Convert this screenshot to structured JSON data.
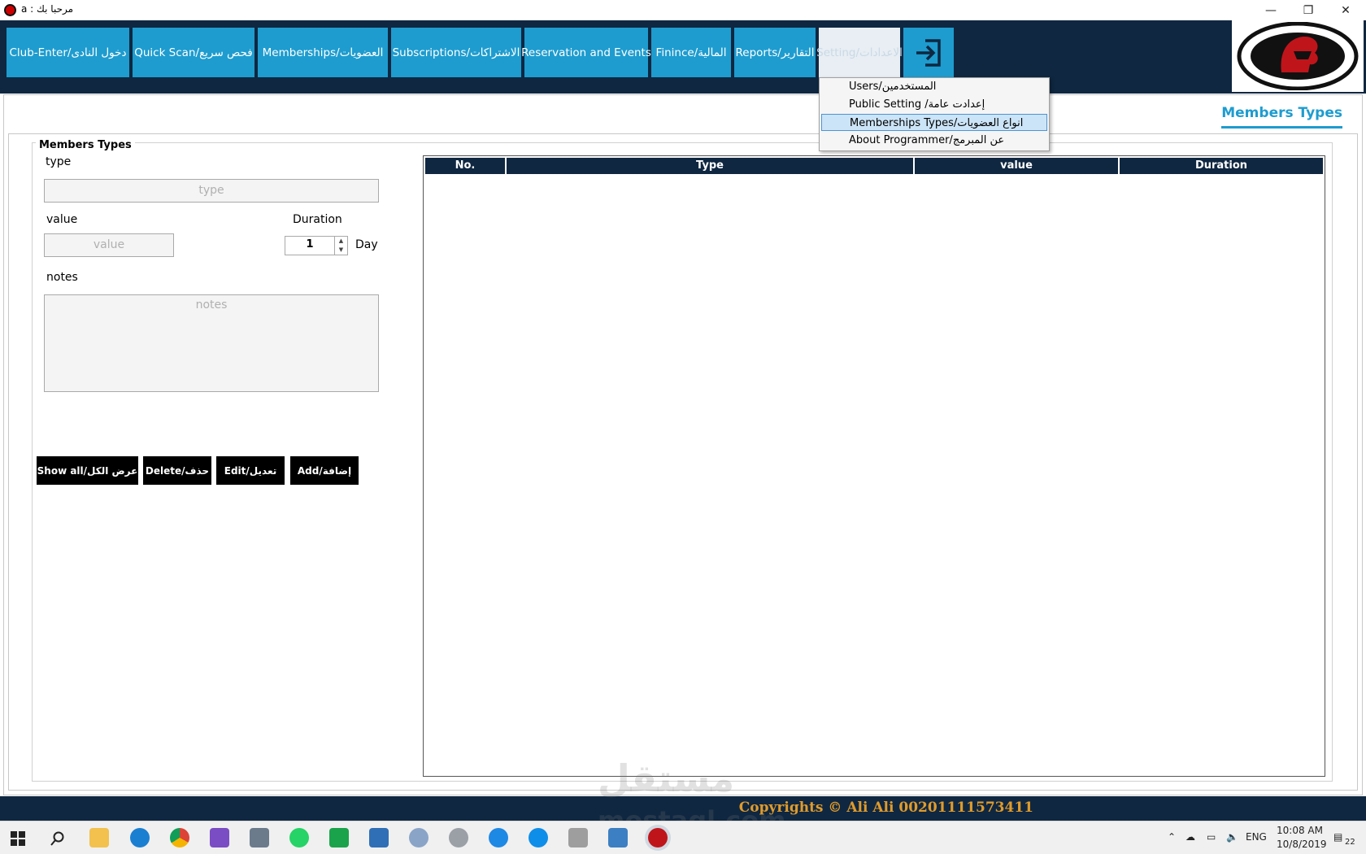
{
  "window": {
    "title": "مرحبا بك : a",
    "minimize_glyph": "—",
    "restore_glyph": "❐",
    "close_glyph": "✕"
  },
  "nav": {
    "items": [
      {
        "label": "Club-Enter/دخول النادى"
      },
      {
        "label": "Quick Scan/فحص سريع"
      },
      {
        "label": "Memberships/العضويات"
      },
      {
        "label": "Subscriptions/الاشتراكات"
      },
      {
        "label": "Reservation and Events"
      },
      {
        "label": "Finince/المالية"
      },
      {
        "label": "Reports/التقارير"
      },
      {
        "label": "Setting/الاعدادات"
      }
    ],
    "exit_icon": "exit-arrow-icon"
  },
  "logo": {
    "text_top": "TITANS GYM",
    "text_bottom": "HEALTH CLUB · SPA · FITNESS"
  },
  "dropdown": {
    "items": [
      {
        "label": "Users/المستخدمين"
      },
      {
        "label": "Public Setting /إعدادت عامة"
      },
      {
        "label": "Memberships Types/انواع العضويات"
      },
      {
        "label": "About Programmer/عن المبرمج"
      }
    ],
    "selected_index": 2
  },
  "page": {
    "title": "Members Types"
  },
  "form": {
    "group_title": "Members Types",
    "type_label": "type",
    "type_placeholder": "type",
    "value_label": "value",
    "value_placeholder": "value",
    "duration_label": "Duration",
    "duration_value": "1",
    "duration_unit": "Day",
    "notes_label": "notes",
    "notes_placeholder": "notes"
  },
  "actions": {
    "show_all": "Show all/عرض الكل",
    "delete": "Delete/حذف",
    "edit": "Edit/تعديل",
    "add": "Add/إضافة"
  },
  "grid": {
    "columns": [
      "No.",
      "Type",
      "value",
      "Duration"
    ],
    "rows": []
  },
  "footer": {
    "copyright": "Copyrights  ©  Ali Ali 00201111573411"
  },
  "watermark": {
    "arabic": "مستقل",
    "latin": "mostaql.com"
  },
  "taskbar": {
    "language": "ENG",
    "time": "10:08 AM",
    "date": "10/8/2019",
    "notification_count": "22"
  },
  "colors": {
    "nav_bg": "#0f2741",
    "nav_button": "#1e9ccf",
    "accent": "#1e9ccf",
    "copyright": "#e09b2b"
  }
}
